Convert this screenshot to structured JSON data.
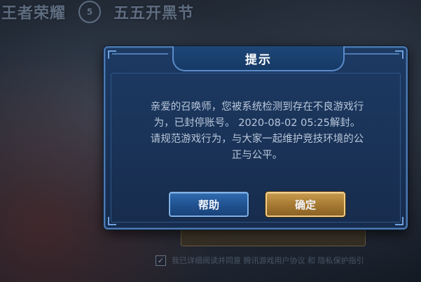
{
  "background": {
    "game_logo": "王者荣耀",
    "event_badge": "5",
    "event_title": "五五开黑节",
    "agreement_text": "我已详细阅读并同意 腾讯游戏用户协议 和 隐私保护指引"
  },
  "dialog": {
    "title": "提示",
    "message_line1": "亲爱的召唤师，您被系统检测到存在不良游戏行",
    "message_line2": "为，已封停账号。 2020-08-02 05:25解封。",
    "message_line3": "请规范游戏行为，与大家一起维护竞技环境的公",
    "message_line4": "正与公平。",
    "help_button": "帮助",
    "ok_button": "确定"
  },
  "colors": {
    "dialog_bg": "#1a3358",
    "dialog_border": "#4d7bb3",
    "help_button": "#2f6bb0",
    "ok_button": "#c89a4e",
    "message_text": "#b9c7da"
  }
}
